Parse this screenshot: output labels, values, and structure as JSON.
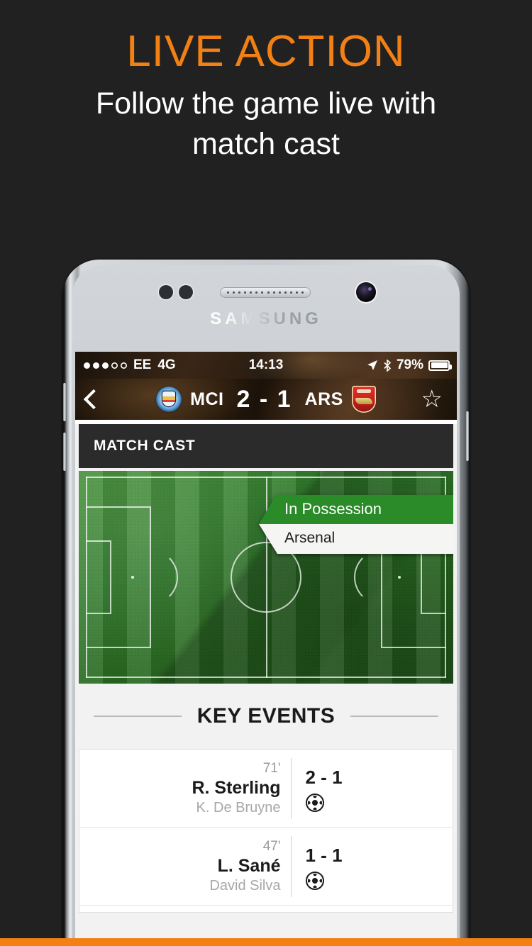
{
  "promo": {
    "title": "LIVE ACTION",
    "subtitle_line1": "Follow the game live with",
    "subtitle_line2": "match cast",
    "accent_color": "#F28014",
    "background_color": "#222121"
  },
  "device": {
    "brand": "SAMSUNG"
  },
  "status_bar": {
    "carrier": "EE",
    "network": "4G",
    "time": "14:13",
    "battery_percent": "79%",
    "signal_dots_filled": 3,
    "signal_dots_total": 5,
    "icons": [
      "location-arrow-icon",
      "bluetooth-icon",
      "battery-icon"
    ]
  },
  "match_header": {
    "back_label": "Back",
    "home_abbr": "MCI",
    "home_crest": "manchester-city-crest",
    "score": "2 - 1",
    "away_abbr": "ARS",
    "away_crest": "arsenal-crest",
    "favourite_icon": "star-outline-icon"
  },
  "match_cast": {
    "panel_title": "MATCH CAST",
    "possession": {
      "label": "In Possession",
      "team": "Arsenal",
      "banner_color": "#2a8b28",
      "body_color": "#f5f5f3"
    }
  },
  "key_events": {
    "title": "KEY EVENTS",
    "events": [
      {
        "minute": "71'",
        "player": "R. Sterling",
        "assist": "K. De Bruyne",
        "score": "2 - 1",
        "icon": "football-icon"
      },
      {
        "minute": "47'",
        "player": "L. Sané",
        "assist": "David Silva",
        "score": "1 - 1",
        "icon": "football-icon"
      }
    ]
  }
}
